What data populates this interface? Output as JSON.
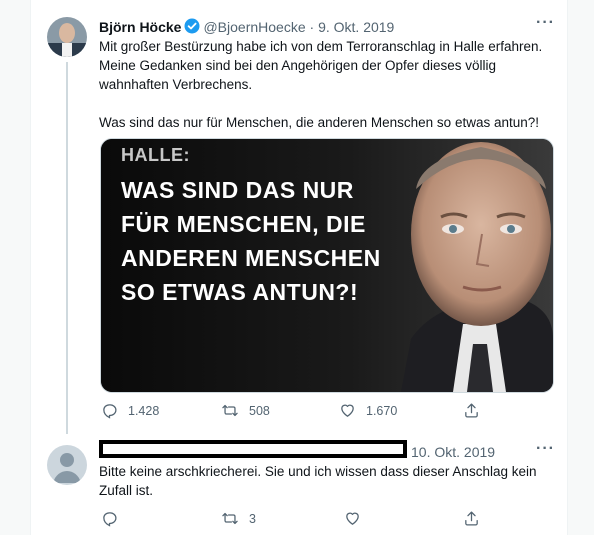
{
  "tweet": {
    "author_name": "Björn Höcke",
    "handle": "@BjoernHoecke",
    "separator": "·",
    "date": "9. Okt. 2019",
    "text": "Mit großer Bestürzung habe ich von dem Terroranschlag in Halle erfahren.\nMeine Gedanken sind bei den Angehörigen der Opfer dieses völlig\nwahnhaften Verbrechens.\n\nWas sind das nur für Menschen, die anderen Menschen so etwas antun?!",
    "media": {
      "kicker": "HALLE:",
      "headline": "WAS SIND DAS NUR\nFÜR MENSCHEN, DIE\nANDEREN MENSCHEN\nSO ETWAS ANTUN?!"
    },
    "counts": {
      "replies": "1.428",
      "retweets": "508",
      "likes": "1.670"
    },
    "verified_color": "#1d9bf0"
  },
  "reply": {
    "date": "10. Okt. 2019",
    "text": "Bitte keine arschkriecherei. Sie und ich wissen dass dieser Anschlag kein\nZufall ist.",
    "counts": {
      "replies": "",
      "retweets": "3",
      "likes": ""
    }
  },
  "more_label": "···",
  "icons": [
    "reply-icon",
    "retweet-icon",
    "like-icon",
    "share-icon",
    "verified-icon",
    "more-icon"
  ]
}
